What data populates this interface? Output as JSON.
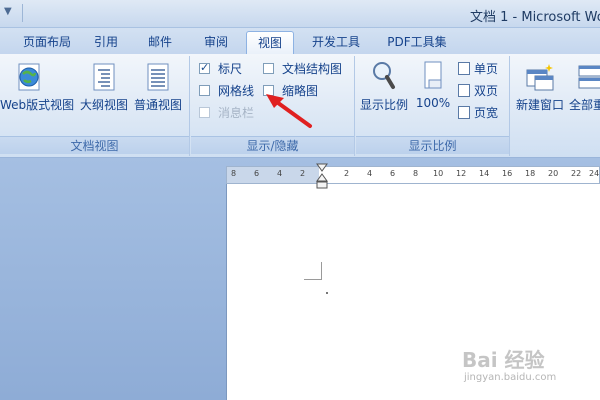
{
  "window": {
    "title": "文档 1 - Microsoft Wo"
  },
  "tabs": [
    {
      "label": "页面布局"
    },
    {
      "label": "引用"
    },
    {
      "label": "邮件"
    },
    {
      "label": "审阅"
    },
    {
      "label": "视图"
    },
    {
      "label": "开发工具"
    },
    {
      "label": "PDF工具集"
    }
  ],
  "active_tab": "视图",
  "groups": {
    "doc_views": {
      "label": "文档视图",
      "web_label": "Web",
      "outline_view": "版式视图",
      "draft_view": "大纲视图",
      "normal_view": "普通视图"
    },
    "show_hide": {
      "label": "显示/隐藏",
      "ruler": {
        "label": "标尺",
        "checked": true
      },
      "gridlines": {
        "label": "网格线",
        "checked": false
      },
      "message_bar": {
        "label": "消息栏",
        "checked": false,
        "disabled": true
      },
      "doc_map": {
        "label": "文档结构图",
        "checked": false
      },
      "thumbnails": {
        "label": "缩略图",
        "checked": false
      }
    },
    "zoom": {
      "label": "显示比例",
      "zoom_button": "显示比例",
      "hundred_button": "100%",
      "one_page": "单页",
      "two_pages": "双页",
      "page_width": "页宽"
    },
    "window": {
      "new_window": "新建窗口",
      "arrange_all": "全部重"
    }
  },
  "ruler": {
    "ticks": [
      "8",
      "6",
      "4",
      "2",
      "2",
      "4",
      "6",
      "8",
      "10",
      "12",
      "14",
      "16",
      "18",
      "20",
      "22",
      "24"
    ]
  },
  "watermark": {
    "text": "Bai 经验",
    "url": "jingyan.baidu.com"
  },
  "colors": {
    "ribbon_text": "#15428b",
    "annotation_arrow": "#e02020",
    "workspace": "#9fb9dc"
  }
}
